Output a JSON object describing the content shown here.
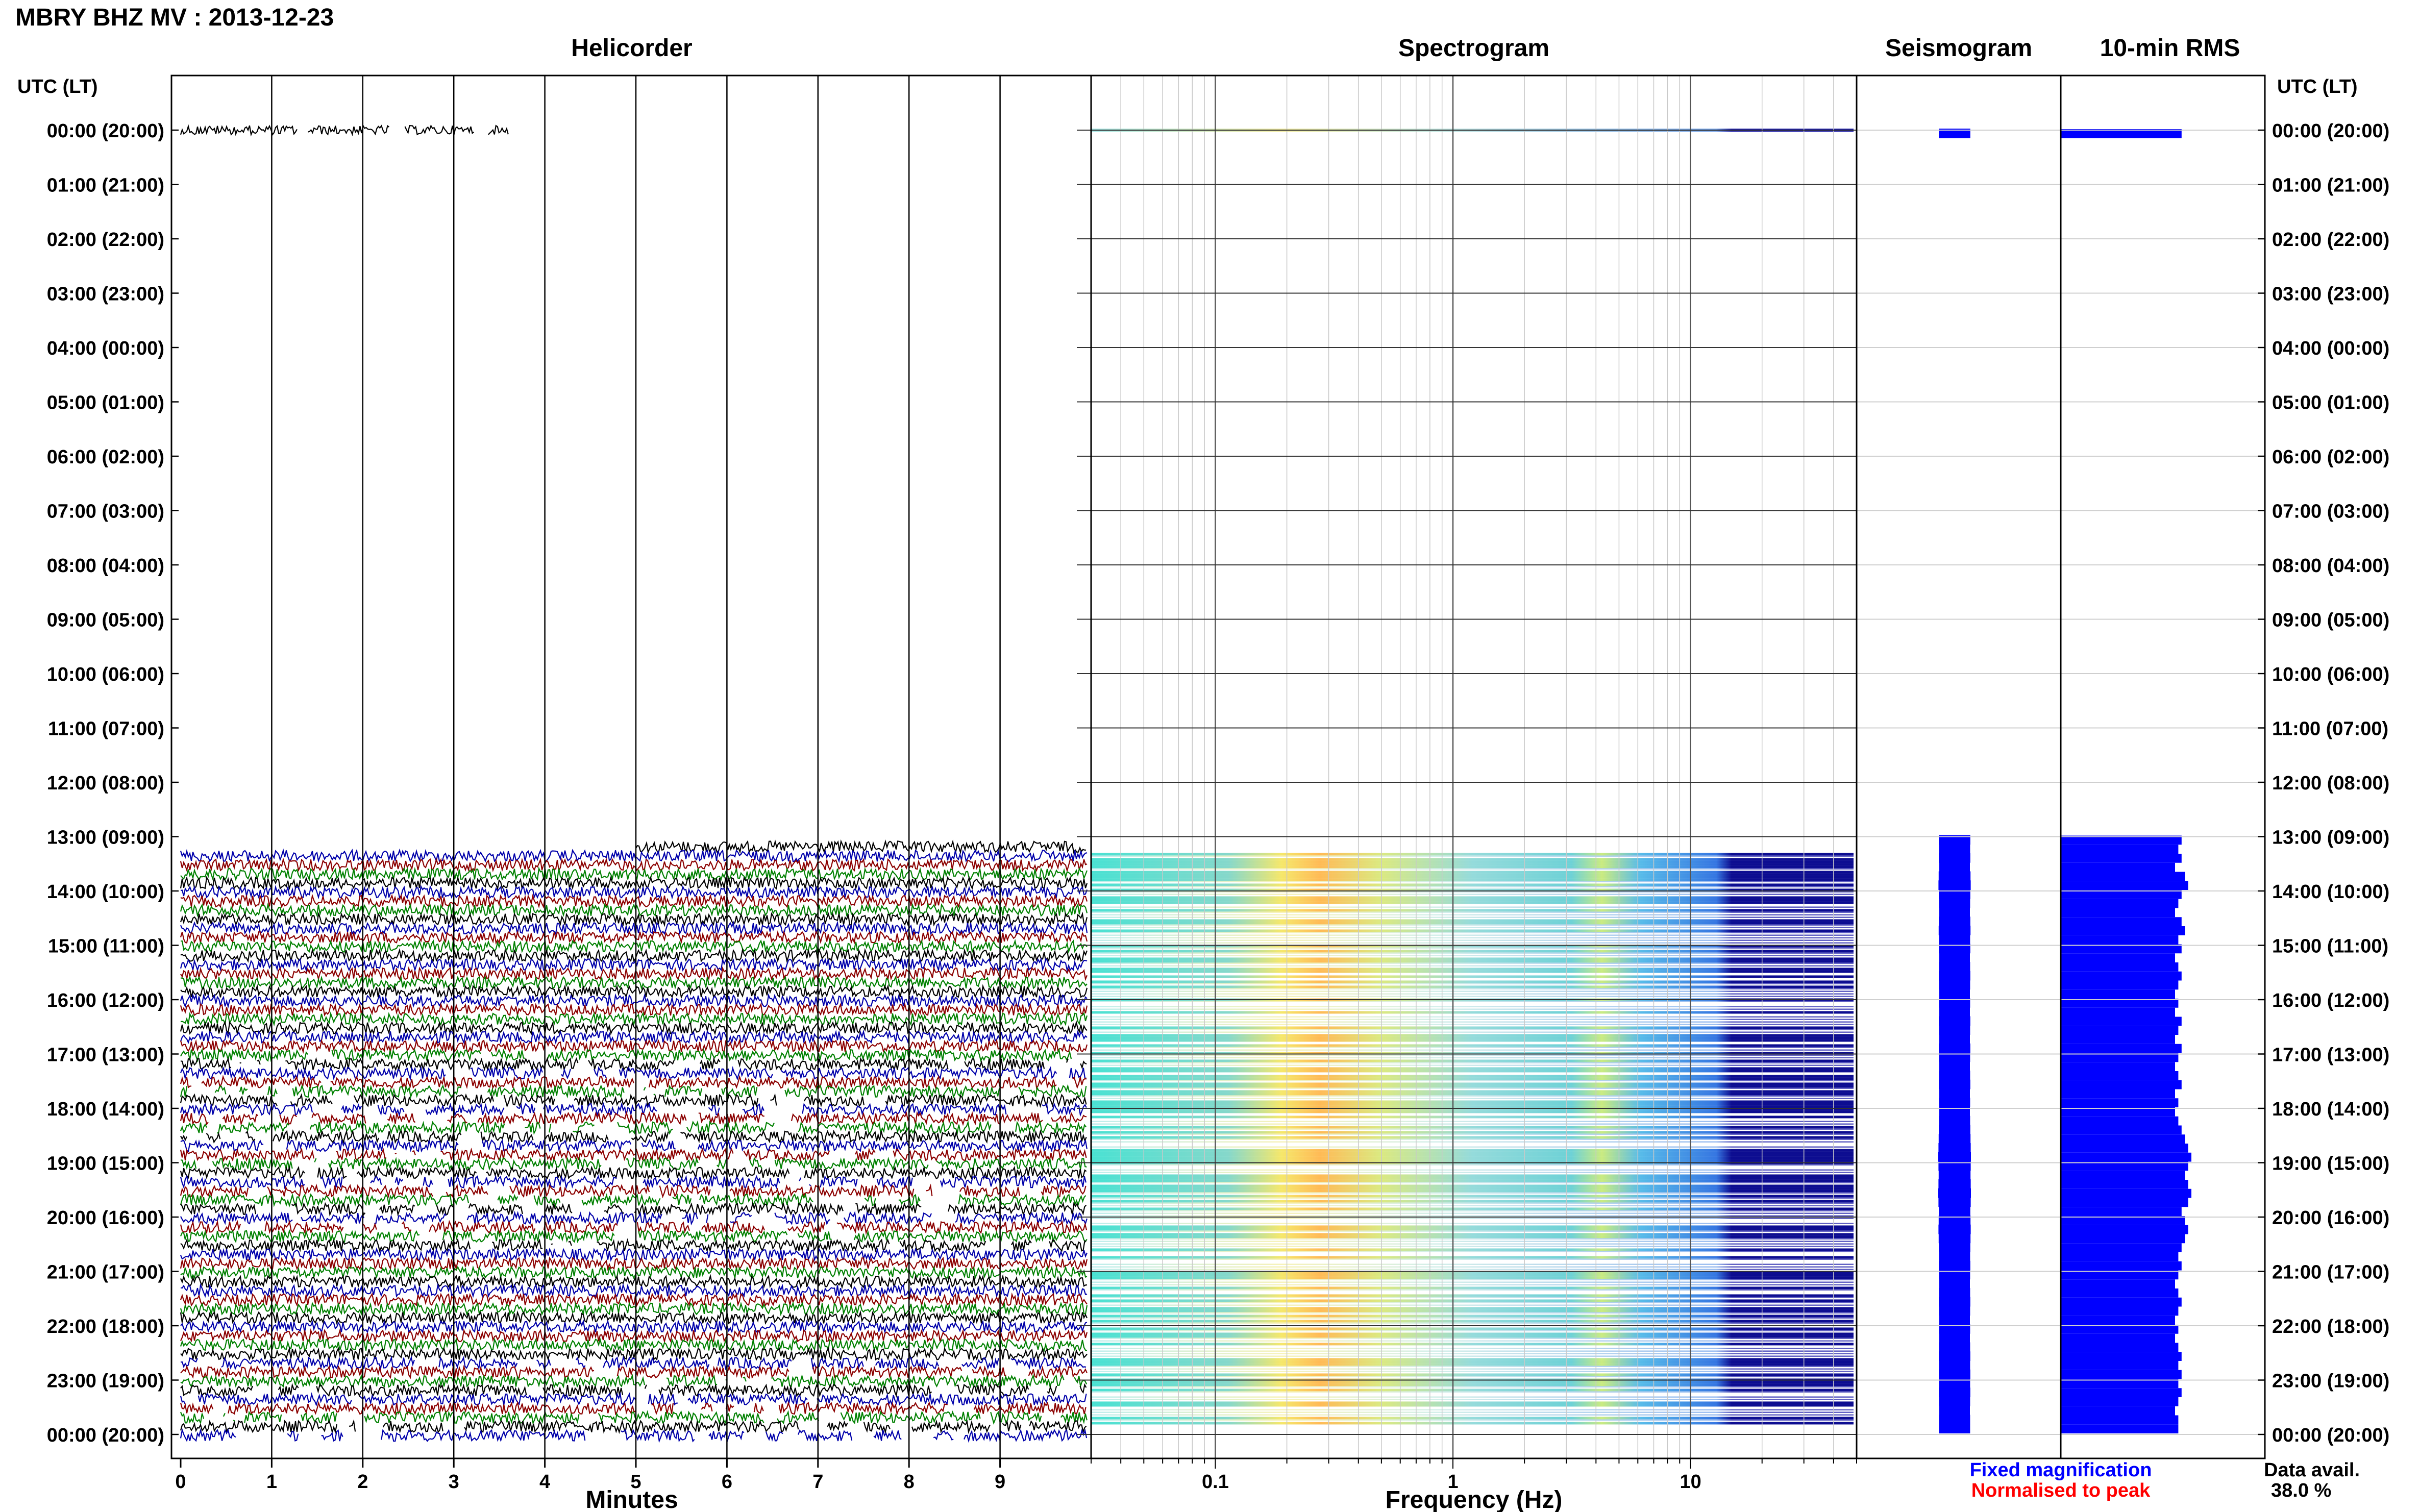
{
  "header": {
    "title": "MBRY BHZ MV : 2013-12-23",
    "utc_label_left": "UTC (LT)",
    "utc_label_right": "UTC (LT)"
  },
  "panels": {
    "helicorder": "Helicorder",
    "spectrogram": "Spectrogram",
    "seismogram": "Seismogram",
    "rms": "10-min RMS"
  },
  "axes": {
    "helicorder_xlabel": "Minutes",
    "spectrogram_xlabel": "Frequency (Hz)",
    "minute_ticks": [
      "0",
      "1",
      "2",
      "3",
      "4",
      "5",
      "6",
      "7",
      "8",
      "9"
    ],
    "frequency_ticks": [
      "0.1",
      "1",
      "10"
    ]
  },
  "time_labels": [
    "00:00 (20:00)",
    "01:00 (21:00)",
    "02:00 (22:00)",
    "03:00 (23:00)",
    "04:00 (00:00)",
    "05:00 (01:00)",
    "06:00 (02:00)",
    "07:00 (03:00)",
    "08:00 (04:00)",
    "09:00 (05:00)",
    "10:00 (06:00)",
    "11:00 (07:00)",
    "12:00 (08:00)",
    "13:00 (09:00)",
    "14:00 (10:00)",
    "15:00 (11:00)",
    "16:00 (12:00)",
    "17:00 (13:00)",
    "18:00 (14:00)",
    "19:00 (15:00)",
    "20:00 (16:00)",
    "21:00 (17:00)",
    "22:00 (18:00)",
    "23:00 (19:00)",
    "00:00 (20:00)"
  ],
  "footer": {
    "legend_fixed": "Fixed magnification",
    "legend_normalised": "Normalised to peak",
    "data_avail_label": "Data avail.",
    "data_avail_value": "38.0 %"
  },
  "colors": {
    "trace_cycle": [
      "#000000",
      "#0000aa",
      "#8b0000",
      "#008000"
    ],
    "rms_fill": "#0000ff",
    "legend_fixed": "#0000ff",
    "legend_normalised": "#ff0000",
    "spectro_low": "#00008b",
    "spectro_mid": "#00bcd4",
    "spectro_high": "#ffd700"
  },
  "chart_data": {
    "type": "heatmap",
    "title": "MBRY BHZ MV : 2013-12-23",
    "xlabel": "Frequency (Hz)",
    "freq_range_hz": [
      0.03,
      50
    ],
    "x_scale": "log",
    "hours_utc": [
      0,
      1,
      2,
      3,
      4,
      5,
      6,
      7,
      8,
      9,
      10,
      11,
      12,
      13,
      14,
      15,
      16,
      17,
      18,
      19,
      20,
      21,
      22,
      23,
      24
    ],
    "data_gap_hours_utc": [
      0.2,
      13.0
    ],
    "rms_10min_relative": [
      0.74,
      0.0,
      0.0,
      0.0,
      0.0,
      0.0,
      0.0,
      0.0,
      0.0,
      0.0,
      0.0,
      0.0,
      0.0,
      0.0,
      0.0,
      0.0,
      0.0,
      0.0,
      0.0,
      0.0,
      0.0,
      0.0,
      0.0,
      0.0,
      0.0,
      0.0,
      0.0,
      0.0,
      0.0,
      0.0,
      0.0,
      0.0,
      0.0,
      0.0,
      0.0,
      0.0,
      0.0,
      0.0,
      0.0,
      0.0,
      0.0,
      0.0,
      0.0,
      0.0,
      0.0,
      0.0,
      0.0,
      0.0,
      0.0,
      0.0,
      0.0,
      0.0,
      0.0,
      0.0,
      0.0,
      0.0,
      0.0,
      0.0,
      0.0,
      0.0,
      0.0,
      0.0,
      0.0,
      0.0,
      0.0,
      0.0,
      0.0,
      0.0,
      0.0,
      0.0,
      0.0,
      0.0,
      0.0,
      0.0,
      0.0,
      0.0,
      0.0,
      0.0,
      0.74,
      0.72,
      0.74,
      0.7,
      0.76,
      0.78,
      0.74,
      0.72,
      0.7,
      0.74,
      0.76,
      0.72,
      0.74,
      0.7,
      0.72,
      0.74,
      0.72,
      0.7,
      0.72,
      0.7,
      0.74,
      0.72,
      0.7,
      0.74,
      0.72,
      0.7,
      0.72,
      0.74,
      0.7,
      0.72,
      0.7,
      0.72,
      0.74,
      0.76,
      0.78,
      0.8,
      0.78,
      0.76,
      0.78,
      0.8,
      0.78,
      0.74,
      0.76,
      0.78,
      0.76,
      0.74,
      0.72,
      0.74,
      0.72,
      0.7,
      0.72,
      0.74,
      0.72,
      0.7,
      0.72,
      0.7,
      0.72,
      0.74,
      0.72,
      0.74,
      0.72,
      0.74,
      0.72,
      0.7,
      0.72,
      0.72
    ]
  }
}
